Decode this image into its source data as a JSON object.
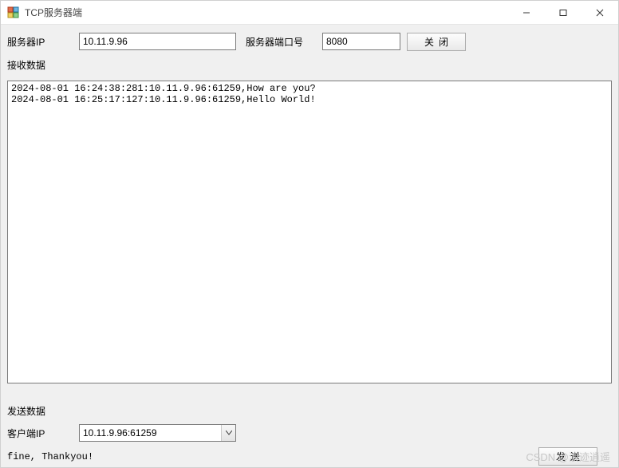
{
  "window": {
    "title": "TCP服务器端"
  },
  "labels": {
    "server_ip": "服务器IP",
    "server_port": "服务器端口号",
    "recv": "接收数据",
    "send_section": "发送数据",
    "client_ip": "客户端IP"
  },
  "fields": {
    "server_ip": "10.11.9.96",
    "server_port": "8080",
    "client_ip_selected": "10.11.9.96:61259",
    "send_text": "fine, Thankyou!"
  },
  "buttons": {
    "close_server": "关闭",
    "send": "发送"
  },
  "recv_lines": [
    "2024-08-01 16:24:38:281:10.11.9.96:61259,How are you?",
    "2024-08-01 16:25:17:127:10.11.9.96:61259,Hello World!"
  ],
  "watermark": "CSDN @浪迹逍遥"
}
